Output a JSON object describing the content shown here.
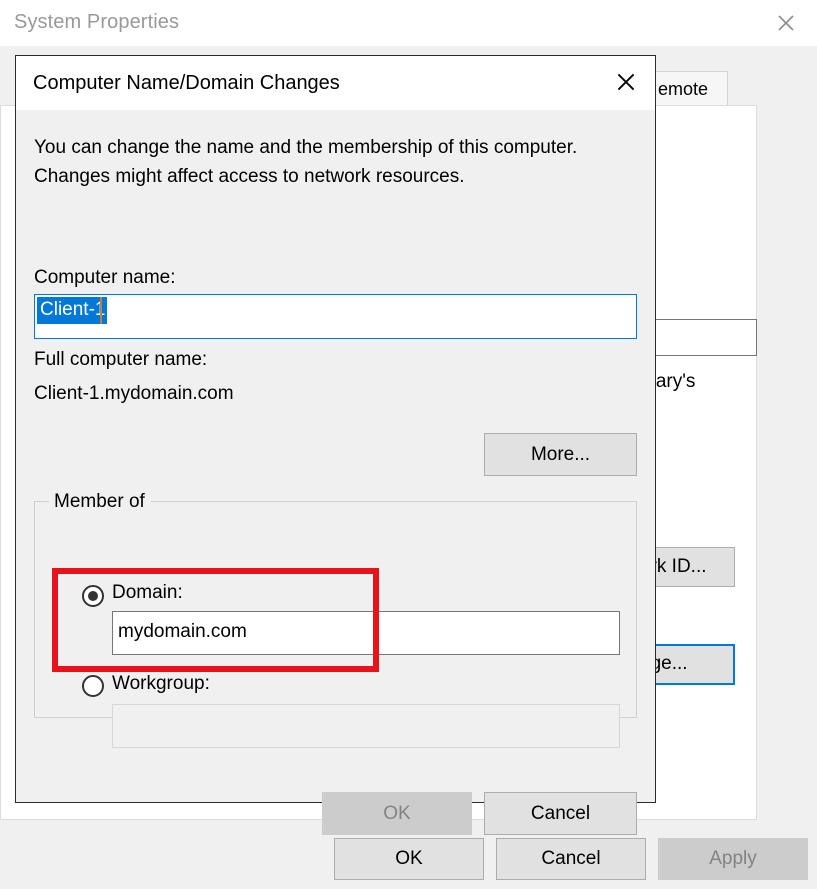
{
  "background_window": {
    "title": "System Properties",
    "close_icon": "close-icon",
    "tab_label": "emote",
    "text_fragment_r": "r",
    "text_fragment_mary": "Mary's",
    "network_id_button": "ork ID...",
    "change_button": "nge...",
    "buttons": {
      "ok": "OK",
      "cancel": "Cancel",
      "apply": "Apply"
    }
  },
  "dialog": {
    "title": "Computer Name/Domain Changes",
    "close_icon": "close-icon",
    "description": "You can change the name and the membership of this computer. Changes might affect access to network resources.",
    "computer_name_label": "Computer name:",
    "computer_name_value": "Client-1",
    "full_computer_name_label": "Full computer name:",
    "full_computer_name_value": "Client-1.mydomain.com",
    "more_button": "More...",
    "member_of": {
      "group_label": "Member of",
      "domain_label": "Domain:",
      "domain_value": "mydomain.com",
      "workgroup_label": "Workgroup:",
      "workgroup_value": ""
    },
    "buttons": {
      "ok": "OK",
      "cancel": "Cancel"
    }
  },
  "colors": {
    "accent": "#0078d7",
    "annotation": "#e8121b",
    "window_bg": "#f0f0f0",
    "button_bg": "#e1e1e1",
    "disabled_text": "#838383"
  }
}
